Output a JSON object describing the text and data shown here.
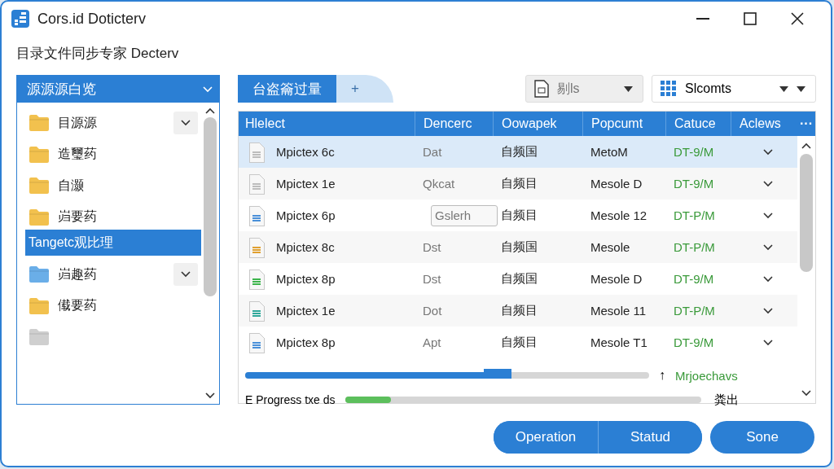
{
  "window": {
    "title": "Cors.id Doticterv",
    "subtitle": "目录文件同步专家 Decterv"
  },
  "source_panel": {
    "title": "源源源白览",
    "items": [
      {
        "label": "目源源",
        "color": "#f2c14e",
        "has_menu": true,
        "selected": false
      },
      {
        "label": "造璽药",
        "color": "#f2c14e",
        "has_menu": false,
        "selected": false
      },
      {
        "label": "自灏",
        "color": "#f2c14e",
        "has_menu": false,
        "selected": false
      },
      {
        "label": "岿要药",
        "color": "#f2c14e",
        "has_menu": false,
        "selected": false
      },
      {
        "label": "Tangetc观比理",
        "has_menu": false,
        "selected": true
      },
      {
        "label": "岿趣药",
        "color": "#6aaee8",
        "has_menu": true,
        "selected": false
      },
      {
        "label": "傤要药",
        "color": "#f2c14e",
        "has_menu": false,
        "selected": false
      },
      {
        "color": "#cfcfcf",
        "has_menu": false,
        "selected": false
      }
    ]
  },
  "tabs": [
    {
      "label": "台盗籥过量",
      "selected": true
    },
    {
      "label": "+",
      "selected": false
    }
  ],
  "filters": [
    {
      "label": "剔ls",
      "kind": "document"
    },
    {
      "label": "Slcomts",
      "kind": "grid"
    }
  ],
  "table": {
    "columns": [
      "Hlelect",
      "Dencerc",
      "Oowapek",
      "Popcumt",
      "Catuce",
      "Aclews",
      "···"
    ],
    "rows": [
      {
        "name": "Mpictex 6c",
        "color": "#bdbdbd",
        "col2": "Dat",
        "kind": "text",
        "col3": "自频国",
        "col4": "MetoM",
        "status": "DT-9/M",
        "selected": true
      },
      {
        "name": "Mpictex 1e",
        "color": "#bdbdbd",
        "col2": "Qkcat",
        "kind": "text",
        "col3": "自频目",
        "col4": "Mesole D",
        "status": "DT-9/M",
        "selected": false
      },
      {
        "name": "Mpictex 6p",
        "color": "#4a90d9",
        "col2": "Gslerh",
        "kind": "field",
        "col3": "自频目",
        "col4": "Mesole 12",
        "status": "DT-P/M",
        "selected": false
      },
      {
        "name": "Mpictex 8c",
        "color": "#e0a030",
        "col2": "Dst",
        "kind": "text",
        "col3": "自频国",
        "col4": "Mesole",
        "status": "DT-P/M",
        "selected": false
      },
      {
        "name": "Mpictex 8p",
        "color": "#3cb44b",
        "col2": "Dst",
        "kind": "text",
        "col3": "自频国",
        "col4": "Mesole D",
        "status": "DT-9/M",
        "selected": false
      },
      {
        "name": "Mpictex 1e",
        "color": "#2fa89a",
        "col2": "Dot",
        "kind": "text",
        "col3": "自频目",
        "col4": "Mesole 11",
        "status": "DT-P/M",
        "selected": false
      },
      {
        "name": "Mpictex 8p",
        "color": "#4a90d9",
        "col2": "Apt",
        "kind": "text",
        "col3": "自频目",
        "col4": "Mesole T1",
        "status": "DT-9/M",
        "selected": false
      }
    ]
  },
  "transfer": {
    "level": 0.6,
    "marker": "↑",
    "reading": "Mrjoechavs"
  },
  "progress": {
    "label": "E Progress txe ds",
    "level": 0.13,
    "reading": "粪出"
  },
  "buttons": [
    "Operation",
    "Statud",
    "Sone"
  ]
}
